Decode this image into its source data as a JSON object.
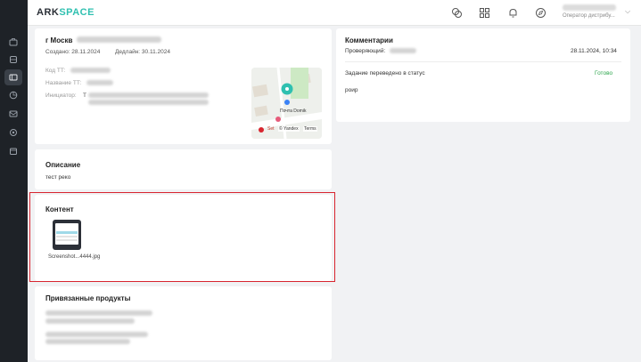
{
  "app": {
    "logo_text": "ARK",
    "logo_accent": "SPACE",
    "user_role": "Оператор дистрибу..."
  },
  "task": {
    "title": "г Москв",
    "created": "Создано: 28.11.2024",
    "deadline": "Дедлайн: 30.11.2024",
    "code_label": "Код ТТ:",
    "name_label": "Название ТТ:",
    "initiator_label": "Инициатор:",
    "initiator_value_start": "Т"
  },
  "map": {
    "place_label": "Почта Domik",
    "attribution": "© Yandex",
    "terms": "Terms",
    "poi_label": "Set"
  },
  "description": {
    "heading": "Описание",
    "text": "тест реко"
  },
  "content": {
    "heading": "Контент",
    "file_name": "Screenshot...4444.jpg"
  },
  "products": {
    "heading": "Привязанные продукты"
  },
  "comments": {
    "heading": "Комментарии",
    "reviewer_label": "Проверяющий:",
    "timestamp": "28.11.2024, 10:34",
    "status_change_text": "Задание переведено в статус",
    "status_value": "Готово",
    "comment_text": "роир"
  },
  "colors": {
    "accent": "#2fc0b0",
    "highlight": "#d8252f",
    "status_ok": "#2da64c",
    "sidebar": "#1e2227"
  },
  "icons": {
    "topbar": [
      "puzzle-icon",
      "grid-icon",
      "bell-icon",
      "compass-icon"
    ],
    "sidebar": [
      "briefcase-icon",
      "database-icon",
      "tasks-icon",
      "chart-icon",
      "mail-icon",
      "settings-icon",
      "calendar-icon"
    ]
  }
}
